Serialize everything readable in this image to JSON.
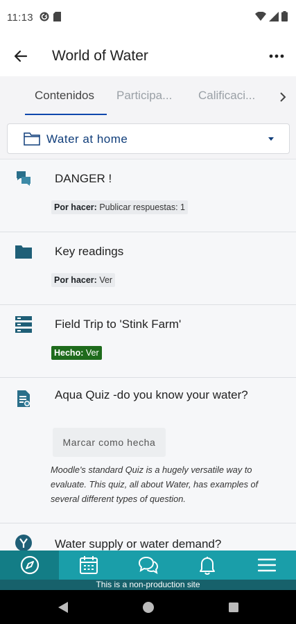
{
  "status_bar": {
    "time": "11:13"
  },
  "header": {
    "title": "World of Water"
  },
  "tabs": [
    {
      "label": "Contenidos"
    },
    {
      "label": "Participa..."
    },
    {
      "label": "Calificaci..."
    }
  ],
  "section_select": {
    "value": "Water at home"
  },
  "activities": [
    {
      "title": "DANGER !",
      "icon": "forum-icon",
      "badge_prefix": "Por hacer:",
      "badge_text": " Publicar respuestas: 1"
    },
    {
      "title": "Key readings",
      "icon": "folder-icon",
      "badge_prefix": "Por hacer:",
      "badge_text": " Ver"
    },
    {
      "title": "Field Trip to 'Stink Farm'",
      "icon": "page-list-icon",
      "badge_prefix": "Hecho:",
      "badge_text": " Ver"
    },
    {
      "title": "Aqua Quiz -do you know your water?",
      "icon": "quiz-icon",
      "button_label": "Marcar como hecha",
      "description": "Moodle's standard Quiz is a hugely versatile way to evaluate. This quiz, all about Water, has examples of several different types of question."
    },
    {
      "title": "Water supply or water demand?",
      "icon": "choice-icon"
    }
  ],
  "bottom_nav": {
    "items": [
      "compass-icon",
      "calendar-icon",
      "messages-icon",
      "bell-icon",
      "menu-icon"
    ]
  },
  "nonprod_notice": "This is a non-production site",
  "colors": {
    "brand": "#1a9ea9",
    "brand_dark": "#17616b",
    "active_tab": "#0f47ad",
    "done_badge": "#1e6b1c",
    "icon_teal": "#1f5f77"
  }
}
